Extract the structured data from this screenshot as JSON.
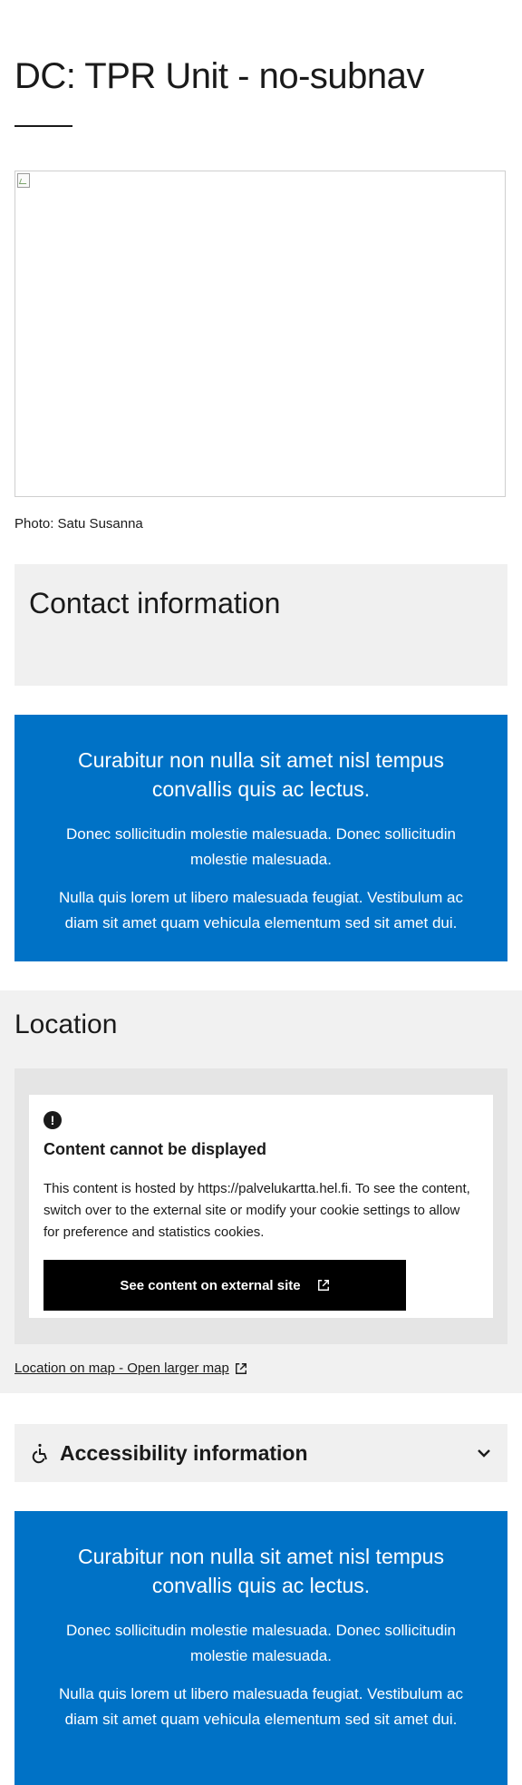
{
  "page": {
    "title": "DC: TPR Unit - no-subnav",
    "photo_caption": "Photo: Satu Susanna"
  },
  "contact": {
    "heading": "Contact information"
  },
  "promo_top": {
    "heading": "Curabitur non nulla sit amet nisl tempus convallis quis ac lectus.",
    "paragraph1": "Donec sollicitudin molestie malesuada. Donec sollicitudin molestie malesuada.",
    "paragraph2": "Nulla quis lorem ut libero malesuada feugiat. Vestibulum ac diam sit amet quam vehicula elementum sed sit amet dui."
  },
  "location": {
    "heading": "Location",
    "notice_icon": "!",
    "notice_title": "Content cannot be displayed",
    "notice_text": "This content is hosted by https://palvelukartta.hel.fi. To see the content, switch over to the external site or modify your cookie settings to allow for preference and statistics cookies.",
    "external_button_label": "See content on external site",
    "map_link_label": "Location on map - Open larger map"
  },
  "accessibility": {
    "label": "Accessibility information"
  },
  "promo_bottom": {
    "heading": "Curabitur non nulla sit amet nisl tempus convallis quis ac lectus.",
    "paragraph1": "Donec sollicitudin molestie malesuada. Donec sollicitudin molestie malesuada.",
    "paragraph2": "Nulla quis lorem ut libero malesuada feugiat. Vestibulum ac diam sit amet quam vehicula elementum sed sit amet dui."
  },
  "colors": {
    "promo_blue": "#0072c6",
    "light_gray": "#f0f0f0",
    "embed_gray": "#e5e5e5",
    "button_black": "#000000"
  },
  "icons": {
    "broken_image": "broken-image-icon",
    "alert": "alert-circle-icon",
    "external_link": "external-link-icon",
    "accessibility": "wheelchair-icon",
    "accordion_toggle": "chevron-down-icon"
  }
}
